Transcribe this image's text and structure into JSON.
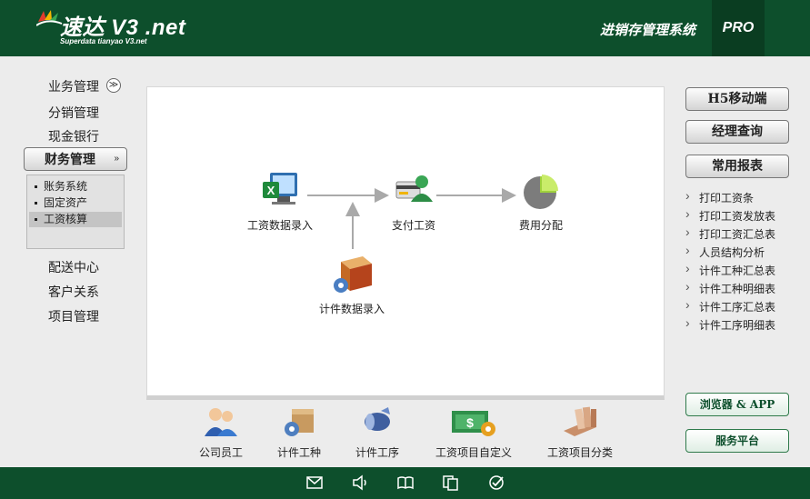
{
  "header": {
    "logo_title": "速达 V3 .net",
    "logo_subtitle": "Superdata tianyao V3.net",
    "system_title": "进销存管理系统",
    "edition": "PRO"
  },
  "left_nav": {
    "items": [
      {
        "label": "业务管理"
      },
      {
        "label": "分销管理"
      },
      {
        "label": "现金银行"
      },
      {
        "label": "财务管理"
      },
      {
        "label": "配送中心"
      },
      {
        "label": "客户关系"
      },
      {
        "label": "项目管理"
      }
    ],
    "collapse_glyph": "≫",
    "active_chevron": "»",
    "sub_items": [
      {
        "label": "账务系统"
      },
      {
        "label": "固定资产"
      },
      {
        "label": "工资核算"
      }
    ]
  },
  "flow": {
    "salary_entry": "工资数据录入",
    "pay_salary": "支付工资",
    "cost_allocation": "费用分配",
    "piece_entry": "计件数据录入"
  },
  "toolbar": {
    "items": [
      {
        "label": "公司员工"
      },
      {
        "label": "计件工种"
      },
      {
        "label": "计件工序"
      },
      {
        "label": "工资项目自定义"
      },
      {
        "label": "工资项目分类"
      }
    ]
  },
  "right_panel": {
    "buttons": [
      {
        "label": "H5移动端"
      },
      {
        "label": "经理查询"
      },
      {
        "label": "常用报表"
      }
    ],
    "links": [
      {
        "label": "打印工资条"
      },
      {
        "label": "打印工资发放表"
      },
      {
        "label": "打印工资汇总表"
      },
      {
        "label": "人员结构分析"
      },
      {
        "label": "计件工种汇总表"
      },
      {
        "label": "计件工种明细表"
      },
      {
        "label": "计件工序汇总表"
      },
      {
        "label": "计件工序明细表"
      }
    ],
    "green_buttons": [
      {
        "label": "浏览器 & APP"
      },
      {
        "label": "服务平台"
      }
    ]
  },
  "footer": {
    "icons": [
      "mail-icon",
      "speaker-icon",
      "book-icon",
      "documents-icon",
      "check-circle-icon"
    ]
  },
  "colors": {
    "header_green": "#0d4f2c",
    "accent_green": "#2f7a4b"
  }
}
